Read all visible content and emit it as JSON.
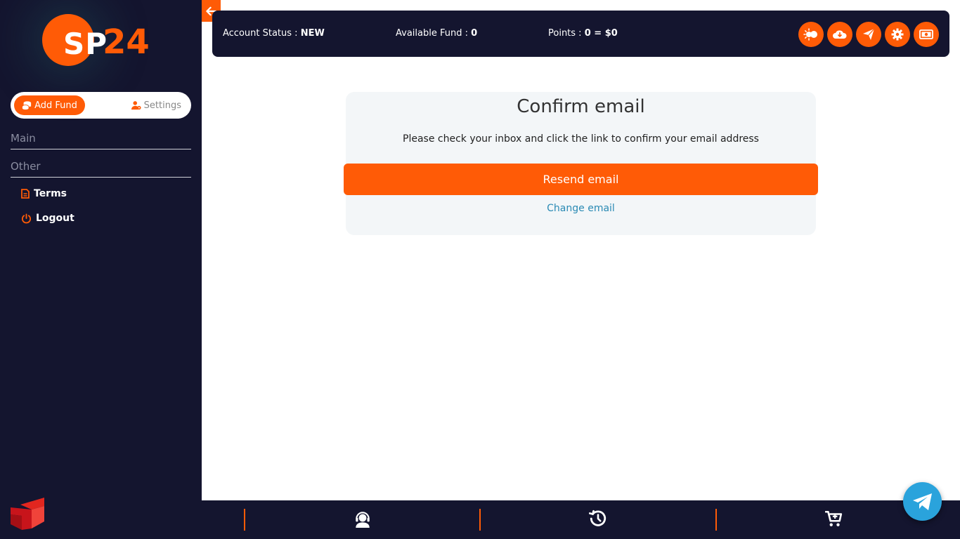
{
  "sidebar": {
    "logo": {
      "text_a": "SP",
      "text_b": "24"
    },
    "add_fund_label": "Add Fund",
    "settings_label": "Settings",
    "main_heading": "Main",
    "other_heading": "Other",
    "items": [
      {
        "label": "Terms",
        "icon": "document-icon"
      },
      {
        "label": "Logout",
        "icon": "power-icon"
      }
    ]
  },
  "topbar": {
    "account_status_label": "Account Status : ",
    "account_status_value": "NEW",
    "available_fund_label": "Available Fund : ",
    "available_fund_value": "0",
    "points_label": "Points : ",
    "points_value": "0 = $0",
    "icons": [
      "sun-moon-icon",
      "cloud-icon",
      "send-icon",
      "gear-icon",
      "money-icon"
    ]
  },
  "card": {
    "title": "Confirm email",
    "message": "Please check your inbox and click the link to confirm your email address",
    "resend_label": "Resend email",
    "change_label": "Change email"
  },
  "bottombar": {
    "icons": [
      "support-icon",
      "history-icon",
      "cart-icon"
    ]
  },
  "colors": {
    "accent": "#ff5b06",
    "dark": "#14152f",
    "link": "#2a8ab4",
    "telegram": "#2aa3dc"
  }
}
